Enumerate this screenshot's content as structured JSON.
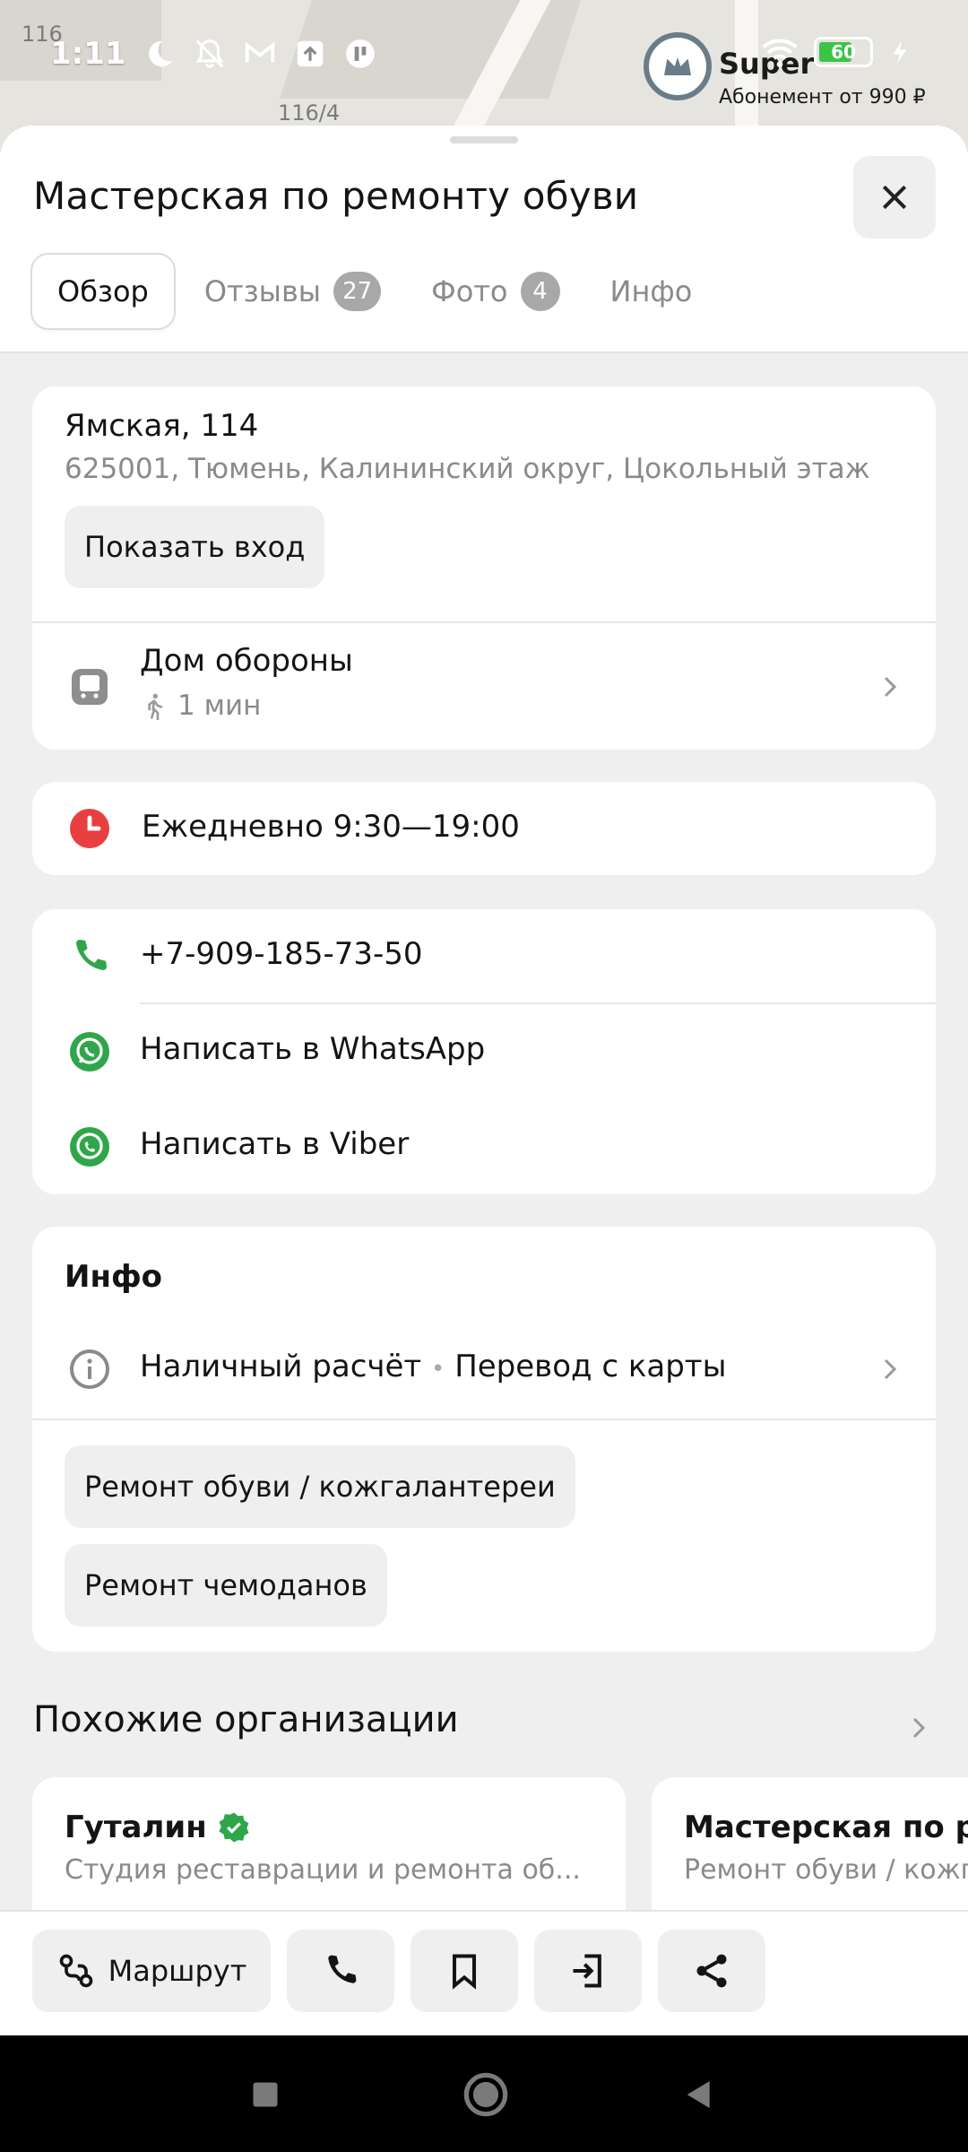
{
  "status_bar": {
    "time": "1:11",
    "battery": "60",
    "map_label_1": "116",
    "map_label_2": "116/4",
    "super_label": "Super",
    "subscription": "Абонемент от 990 ₽"
  },
  "header": {
    "title": "Мастерская по ремонту обуви",
    "tabs": [
      {
        "label": "Обзор",
        "count": ""
      },
      {
        "label": "Отзывы",
        "count": "27"
      },
      {
        "label": "Фото",
        "count": "4"
      },
      {
        "label": "Инфо",
        "count": ""
      }
    ]
  },
  "address": {
    "street": "Ямская, 114",
    "details": "625001, Тюмень, Калининский округ, Цокольный этаж",
    "show_entrance": "Показать вход",
    "stop_name": "Дом обороны",
    "walk_time": "1 мин"
  },
  "hours": {
    "text": "Ежедневно 9:30—19:00",
    "color": "#e84041"
  },
  "contacts": {
    "phone": "+7-909-185-73-50",
    "whatsapp": "Написать в WhatsApp",
    "viber": "Написать в Viber",
    "accent": "#2fa64a"
  },
  "info": {
    "title": "Инфо",
    "payment_cash": "Наличный расчёт",
    "payment_sep": "•",
    "payment_card": "Перевод с карты",
    "tags": [
      "Ремонт обуви / кожгалантереи",
      "Ремонт чемоданов"
    ]
  },
  "similar": {
    "title": "Похожие организации",
    "items": [
      {
        "name": "Гуталин",
        "desc": "Студия реставрации и ремонта об..."
      },
      {
        "name": "Мастерская по ре",
        "desc": "Ремонт обуви / кожг"
      }
    ]
  },
  "actions": {
    "route": "Маршрут"
  }
}
